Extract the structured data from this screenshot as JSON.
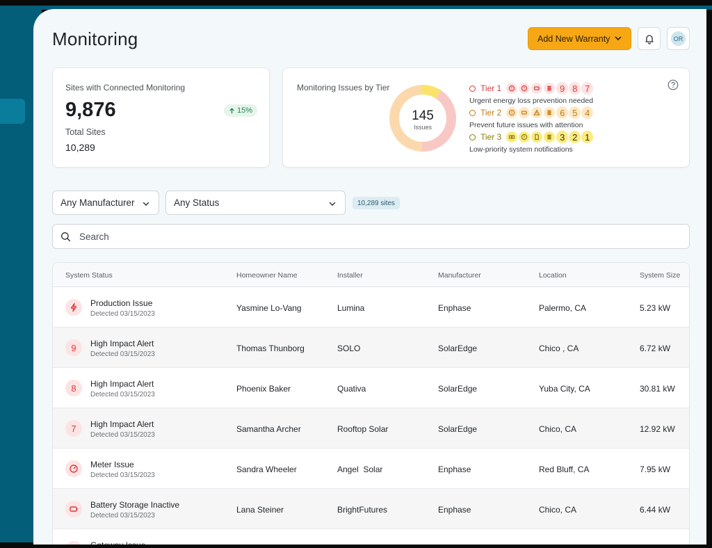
{
  "header": {
    "title": "Monitoring",
    "add_warranty_label": "Add New Warranty",
    "avatar_initials": "OR"
  },
  "summary_card": {
    "label": "Sites with Connected Monitoring",
    "value": "9,876",
    "change": "15%",
    "total_label": "Total Sites",
    "total_value": "10,289"
  },
  "issues_card": {
    "label": "Monitoring Issues by Tier",
    "total": "145",
    "total_label": "Issues",
    "donut": [
      {
        "tier": "Tier 1",
        "color": "#f8c9c4",
        "value": 60
      },
      {
        "tier": "Tier 2",
        "color": "#fbd9ad",
        "value": 70
      },
      {
        "tier": "Tier 3",
        "color": "#fbe36b",
        "value": 15
      }
    ],
    "tiers": [
      {
        "label": "Tier 1",
        "numbers": [
          "9",
          "8",
          "7"
        ],
        "description": "Urgent energy loss prevention needed",
        "color": "#d73b3b",
        "chip_bg": "#fde3e3",
        "icons": [
          "alert-circle-icon",
          "alert-circle-icon",
          "battery-icon",
          "grid-icon"
        ]
      },
      {
        "label": "Tier 2",
        "numbers": [
          "6",
          "5",
          "4"
        ],
        "description": "Prevent future issues with attention",
        "color": "#c27a12",
        "chip_bg": "#fde8c6",
        "icons": [
          "alert-circle-icon",
          "battery-icon",
          "warning-icon",
          "grid-icon"
        ]
      },
      {
        "label": "Tier 3",
        "numbers": [
          "3",
          "2",
          "1"
        ],
        "description": "Low-priority system notifications",
        "color": "#8a7a0a",
        "chip_bg": "#fbec82",
        "icons": [
          "device-icon",
          "alert-circle-icon",
          "document-icon",
          "grid-icon"
        ]
      }
    ]
  },
  "filters": {
    "manufacturer": "Any Manufacturer",
    "status": "Any Status",
    "sites_count": "10,289 sites",
    "search_placeholder": "Search"
  },
  "table": {
    "columns": [
      "System Status",
      "Homeowner Name",
      "Installer",
      "Manufacturer",
      "Location",
      "System Size"
    ],
    "rows": [
      {
        "icon": "lightning-icon",
        "glyph": "",
        "status": "Production Issue",
        "detected": "Detected 03/15/2023",
        "owner": "Yasmine Lo-Vang",
        "installer": "Lumina",
        "manufacturer": "Enphase",
        "location": "Palermo, CA",
        "size": "5.23 kW"
      },
      {
        "icon": "number-badge",
        "glyph": "9",
        "status": "High Impact Alert",
        "detected": "Detected 03/15/2023",
        "owner": "Thomas Thunborg",
        "installer": "SOLO",
        "manufacturer": "SolarEdge",
        "location": "Chico , CA",
        "size": "6.72 kW"
      },
      {
        "icon": "number-badge",
        "glyph": "8",
        "status": "High Impact Alert",
        "detected": "Detected 03/15/2023",
        "owner": "Phoenix Baker",
        "installer": "Quativa",
        "manufacturer": "SolarEdge",
        "location": "Yuba City, CA",
        "size": "30.81 kW"
      },
      {
        "icon": "number-badge",
        "glyph": "7",
        "status": "High Impact Alert",
        "detected": "Detected 03/15/2023",
        "owner": "Samantha Archer",
        "installer": "Rooftop Solar",
        "manufacturer": "SolarEdge",
        "location": "Chico, CA",
        "size": "12.92 kW"
      },
      {
        "icon": "gauge-icon",
        "glyph": "",
        "status": "Meter Issue",
        "detected": "Detected 03/15/2023",
        "owner": "Sandra Wheeler",
        "installer": "Angel  Solar",
        "manufacturer": "Enphase",
        "location": "Red Bluff, CA",
        "size": "7.95 kW"
      },
      {
        "icon": "battery-icon",
        "glyph": "",
        "status": "Battery Storage Inactive",
        "detected": "Detected 03/15/2023",
        "owner": "Lana Steiner",
        "installer": "BrightFutures",
        "manufacturer": "Enphase",
        "location": "Chico, CA",
        "size": "6.44 kW"
      },
      {
        "icon": "gateway-icon",
        "glyph": "",
        "status": "Gateway Issue",
        "detected": "",
        "owner": "",
        "installer": "",
        "manufacturer": "",
        "location": "",
        "size": ""
      }
    ]
  }
}
